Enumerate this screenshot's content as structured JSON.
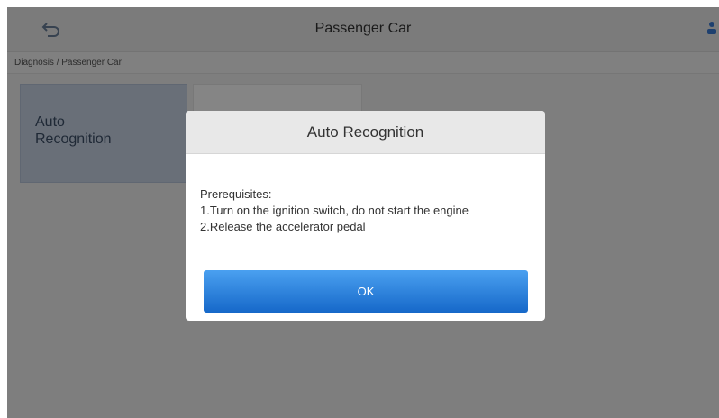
{
  "header": {
    "title": "Passenger Car",
    "back_icon": "back-icon",
    "right_icon": "profile-icon"
  },
  "breadcrumb": "Diagnosis / Passenger Car",
  "tiles": [
    {
      "label": "Auto\nRecognition"
    }
  ],
  "dialog": {
    "title": "Auto Recognition",
    "lines": [
      "Prerequisites:",
      "1.Turn on the ignition switch, do not start the engine",
      "2.Release the accelerator pedal"
    ],
    "ok_label": "OK"
  },
  "colors": {
    "accent": "#1e78d8",
    "tile_selected": "#c9d5e6"
  }
}
